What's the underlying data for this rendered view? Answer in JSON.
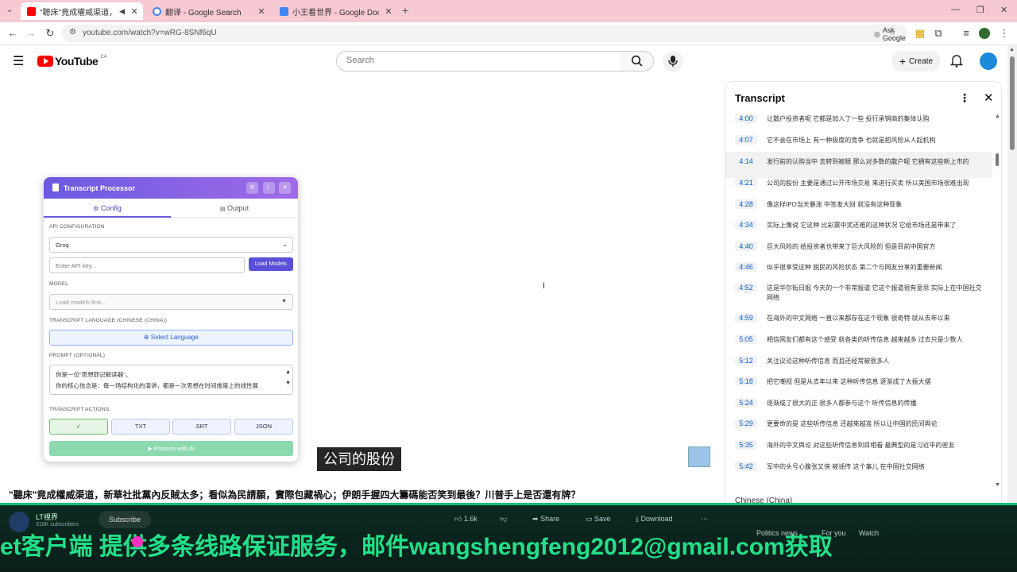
{
  "browser": {
    "tabs": [
      {
        "title": "\"聽床\"竟成權威渠道，新華…",
        "fav_color": "#ff0000"
      },
      {
        "title": "翻译 - Google Search",
        "fav_color": "#4285f4"
      },
      {
        "title": "小王看世界 - Google Docs",
        "fav_color": "#4285f4"
      }
    ],
    "url": "youtube.com/watch?v=wRG-8SNf6qU",
    "ask_google": "Ask Google"
  },
  "yt": {
    "logo_text": "YouTube",
    "country": "CA",
    "search_placeholder": "Search",
    "create_label": "Create"
  },
  "transcript": {
    "title": "Transcript",
    "language": "Chinese (China)",
    "segments": [
      {
        "t": "4:00",
        "text": "让散户投资者呢 它都是加入了一些 投行承销商的集体认购"
      },
      {
        "t": "4:07",
        "text": "它不会在市场上 有一种极度的竞争 也就是把风险从人起机构"
      },
      {
        "t": "4:14",
        "text": "发行前的认购当中 去转到被眼 那么对多数的散户呢 它拥有这些新上市的"
      },
      {
        "t": "4:21",
        "text": "公司的股份 主要是通过公开市场交易 来进行买卖 所以美国市场很难出现"
      },
      {
        "t": "4:28",
        "text": "像这样IPO当天暴涨 中签发大财 就没有这种现象"
      },
      {
        "t": "4:34",
        "text": "实际上像说 它这种 比彩票中奖还难的这种状况 它给市场还是带来了"
      },
      {
        "t": "4:40",
        "text": "巨大风险的 给投资者也带来了巨大风险的 但是目前中国官方"
      },
      {
        "t": "4:46",
        "text": "似乎很享受这种 脱民的风险状态 第二个与网友分享的重要新闻"
      },
      {
        "t": "4:52",
        "text": "这是华尔街日报 今天的一个非常报道 它这个报道很有意思 实际上在中国社交网络"
      },
      {
        "t": "4:59",
        "text": "在海外的中文网络 一直以来都存在这个现象 很奇特 就从去年以来"
      },
      {
        "t": "5:05",
        "text": "相信网友们都有这个感受 就各类的听传信息 越来越多 过去只是少数人"
      },
      {
        "t": "5:12",
        "text": "关注议论这种听传信息 而且还经常被很多人"
      },
      {
        "t": "5:18",
        "text": "把它嘲视 但是从去年以来 这种听传信息 逐渐成了大振大摆"
      },
      {
        "t": "5:24",
        "text": "逐渐成了很大的正 很多人都参与这个 听传信息的传播"
      },
      {
        "t": "5:29",
        "text": "更要命的是 这些听传信息 还越来越准 所以让中国的民间舆论"
      },
      {
        "t": "5:35",
        "text": "海外的中文舆论 对这些听传信息到目相看 最典型的是习近平的密友"
      },
      {
        "t": "5:42",
        "text": "军中的头号心腹张又侠 被谣传 这个事儿 在中国社交网络"
      }
    ]
  },
  "popup": {
    "title": "Transcript Processor",
    "tab_config": "Config",
    "tab_output": "Output",
    "api_config_label": "API CONFIGURATION",
    "provider": "Groq",
    "api_key_placeholder": "Enter API key...",
    "load_models": "Load Models",
    "model_label": "MODEL",
    "model_placeholder": "Load models first...",
    "lang_label": "TRANSCRIPT LANGUAGE  (CHINESE (CHINA))",
    "select_language": "Select Language",
    "prompt_label": "PROMPT (OPTIONAL)",
    "prompt_line1": "你是一位\"思想即记解读器\"。",
    "prompt_line2": "你的核心信念是：每一场结构化的演讲，都是一次思想在时间维度上的线性展",
    "actions_label": "TRANSCRIPT ACTIONS",
    "actions": [
      "✓",
      "TXT",
      "SRT",
      "JSON"
    ],
    "process": "▶ Process with AI"
  },
  "video": {
    "subtitle": "公司的股份",
    "title": "\"聽床\"竟成權威渠道，新華社批黨內反賊太多；看似為民請願，實際包藏禍心；伊朗手握四大籌碼能否笑到最後？川普手上是否還有牌？"
  },
  "channel": {
    "name": "LT視界",
    "subs": "316K subscribers",
    "subscribe": "Subscribe",
    "likes": "1.6k",
    "share": "Share",
    "save": "Save",
    "download": "Download",
    "news_label": "Politics news",
    "for_you": "For you",
    "watched": "Watch"
  },
  "overlay": {
    "marquee": "et客户端    提供多条线路保证服务，邮件wangshengfeng2012@gmail.com获取"
  }
}
